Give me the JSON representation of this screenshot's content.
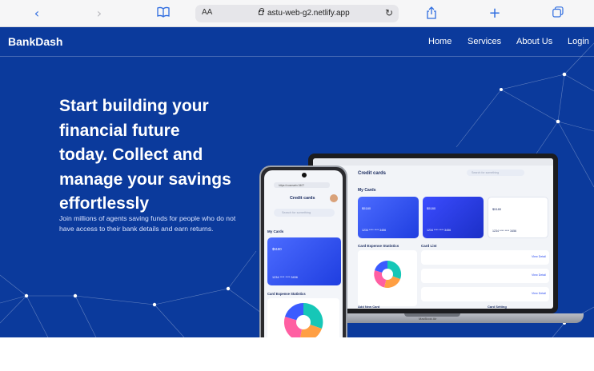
{
  "browser": {
    "text_size_label": "AA",
    "url": "astu-web-g2.netlify.app"
  },
  "navbar": {
    "brand": "BankDash",
    "links": [
      "Home",
      "Services",
      "About Us",
      "Login"
    ]
  },
  "hero": {
    "headline_lines": [
      "Start building your",
      "financial future",
      "today. Collect and",
      "manage your savings",
      "effortlessly"
    ],
    "subtext": "Join millions of agents saving funds for people who do not have access to their bank details and earn returns."
  },
  "laptop_screen": {
    "title": "Credit cards",
    "search_placeholder": "Search for something",
    "my_cards": "My Cards",
    "cards": [
      {
        "balance_label": "Balance",
        "balance": "$5180",
        "number": "1234 **** **** 3456"
      },
      {
        "balance_label": "Balance",
        "balance": "$5180",
        "number": "1234 **** **** 3456"
      },
      {
        "balance_label": "Balance",
        "balance": "$5180",
        "number": "1234 **** **** 3456"
      }
    ],
    "stats_title": "Card Expense Statistics",
    "list_title": "Card List",
    "list_action": "View Detail",
    "add_card": "Add New Card",
    "card_setting": "Card Setting",
    "base_label": "MacBook Air"
  },
  "phone_screen": {
    "url": "https://cusmartv.3407",
    "title": "Credit cards",
    "search_placeholder": "Search for something",
    "my_cards": "My Cards",
    "card_balance": "$5180",
    "card_number": "1234 **** **** 3456",
    "stats_title": "Card Expense Statistics"
  },
  "colors": {
    "hero_bg": "#0b3a9c",
    "card_blue": "#2d4df0",
    "pie_teal": "#16c7b7",
    "pie_orange": "#ff9f43",
    "pie_pink": "#ff5fa2",
    "pie_blue": "#3b5bff"
  }
}
